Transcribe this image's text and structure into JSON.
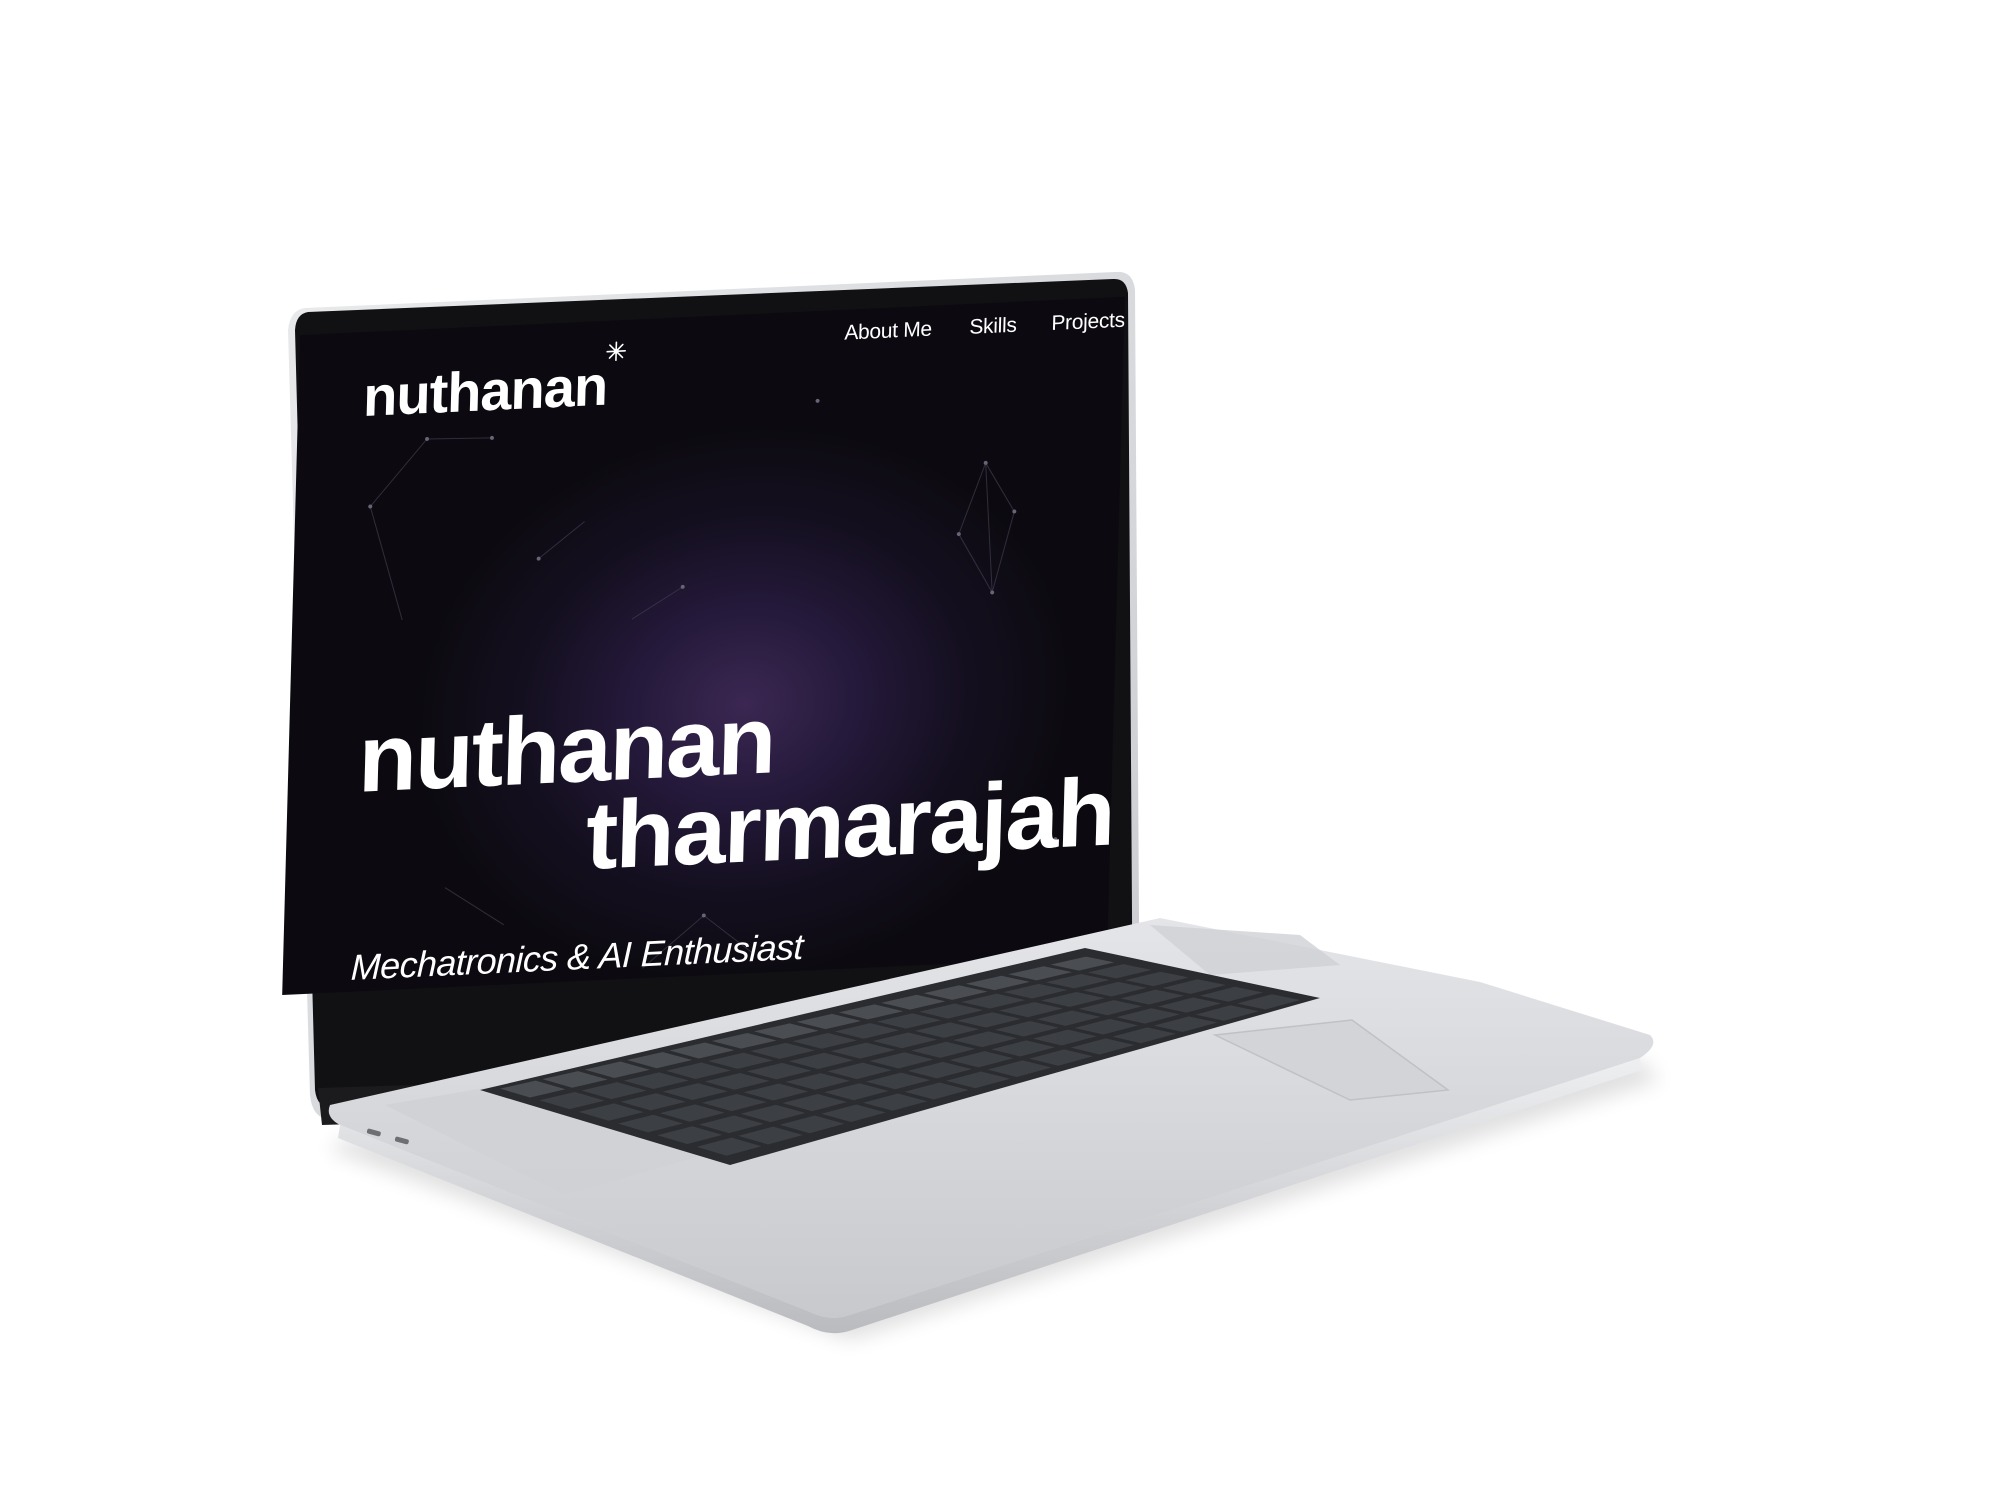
{
  "site": {
    "logo_text": "nuthanan",
    "logo_icon": "asterisk-star-icon",
    "nav": {
      "about": "About Me",
      "skills": "Skills",
      "projects": "Projects"
    },
    "hero": {
      "line1": "nuthanan",
      "line2": "tharmarajah",
      "tagline": "Mechatronics & AI Enthusiast"
    }
  },
  "colors": {
    "background_dark": "#0c0a10",
    "background_glow": "#3b2752",
    "text": "#ffffff",
    "laptop_body": "#d6d8dc",
    "keyboard_well": "#2e3034",
    "keys": "#3c3f44"
  },
  "icons": [
    "asterisk-star-icon"
  ]
}
